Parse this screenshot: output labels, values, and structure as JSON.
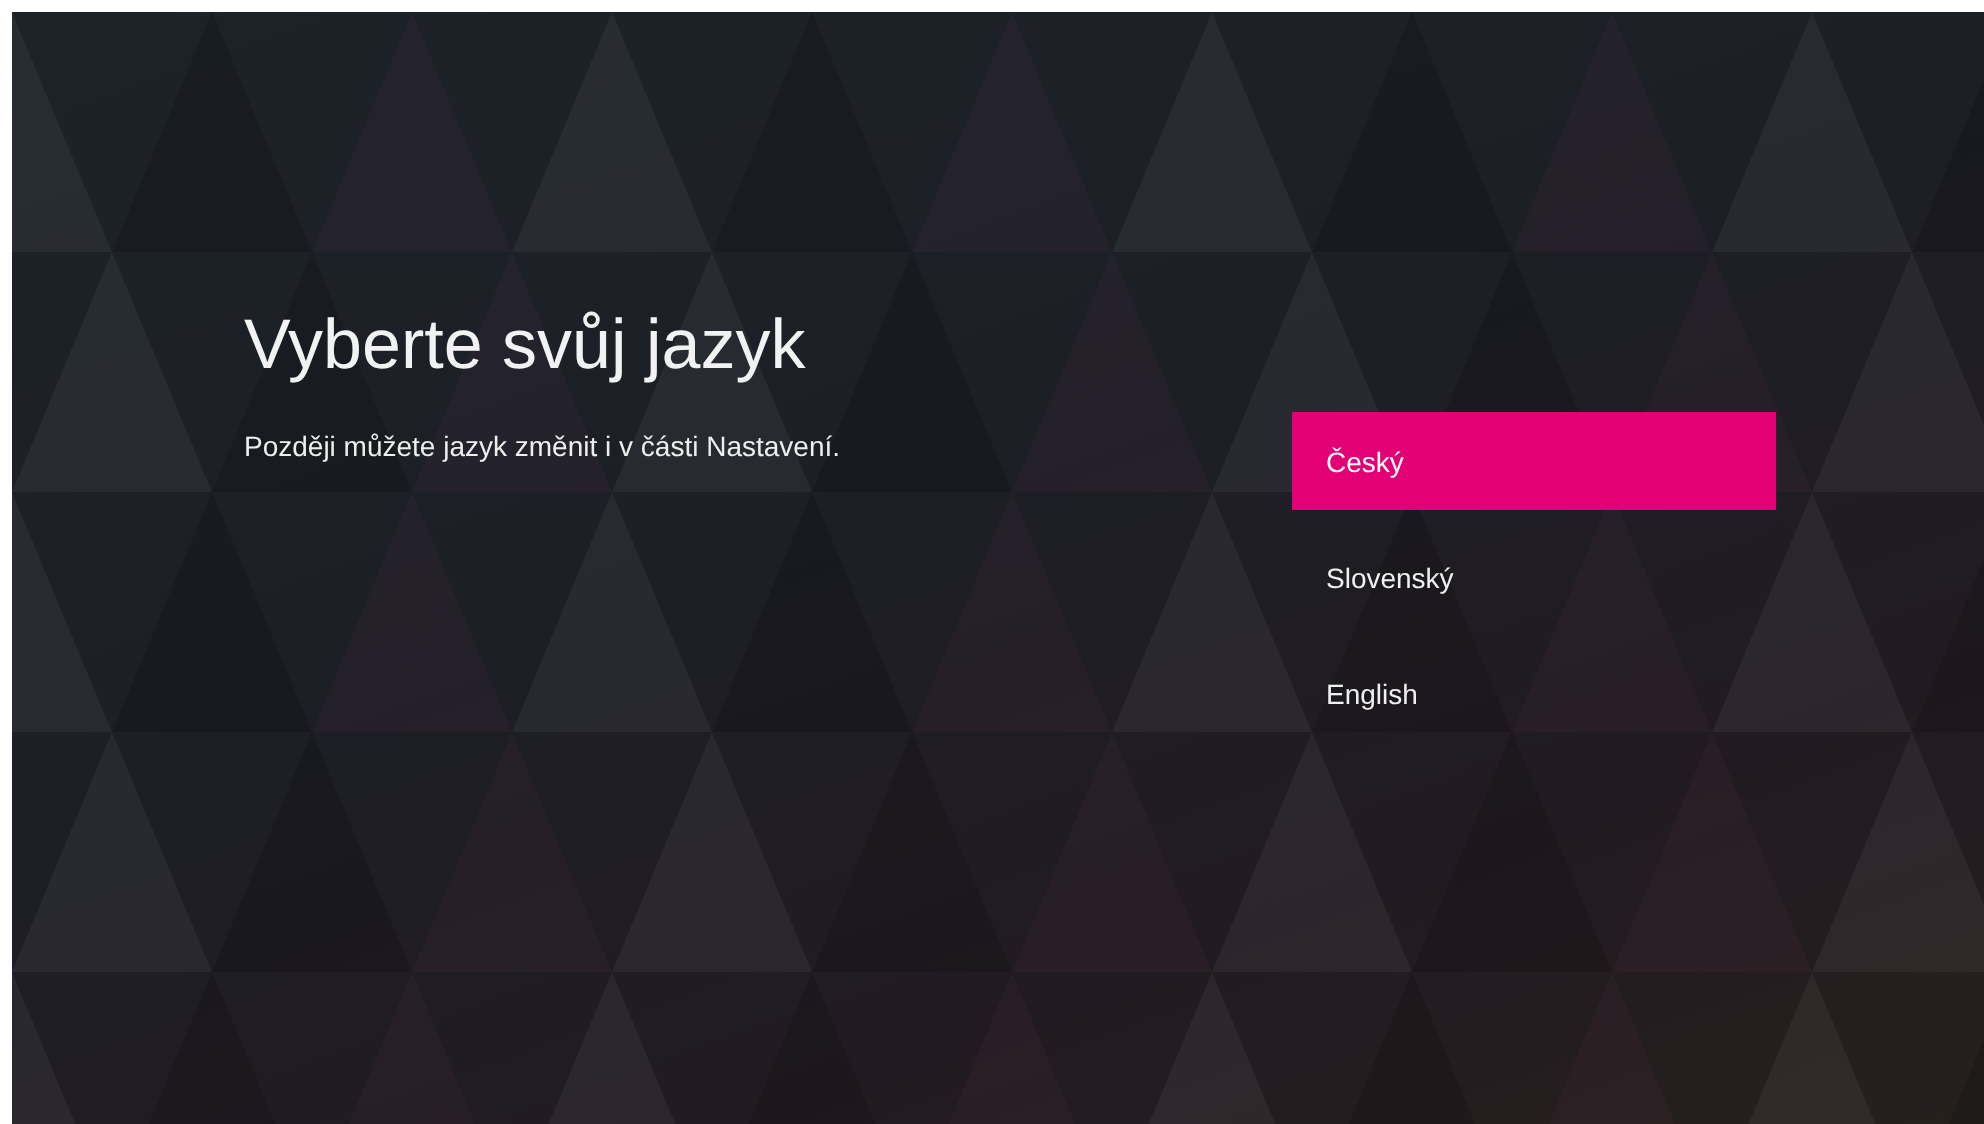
{
  "heading": {
    "title": "Vyberte svůj jazyk",
    "subtitle": "Později můžete jazyk změnit i v části Nastavení."
  },
  "languages": [
    {
      "label": "Český",
      "selected": true
    },
    {
      "label": "Slovenský",
      "selected": false
    },
    {
      "label": "English",
      "selected": false
    }
  ]
}
